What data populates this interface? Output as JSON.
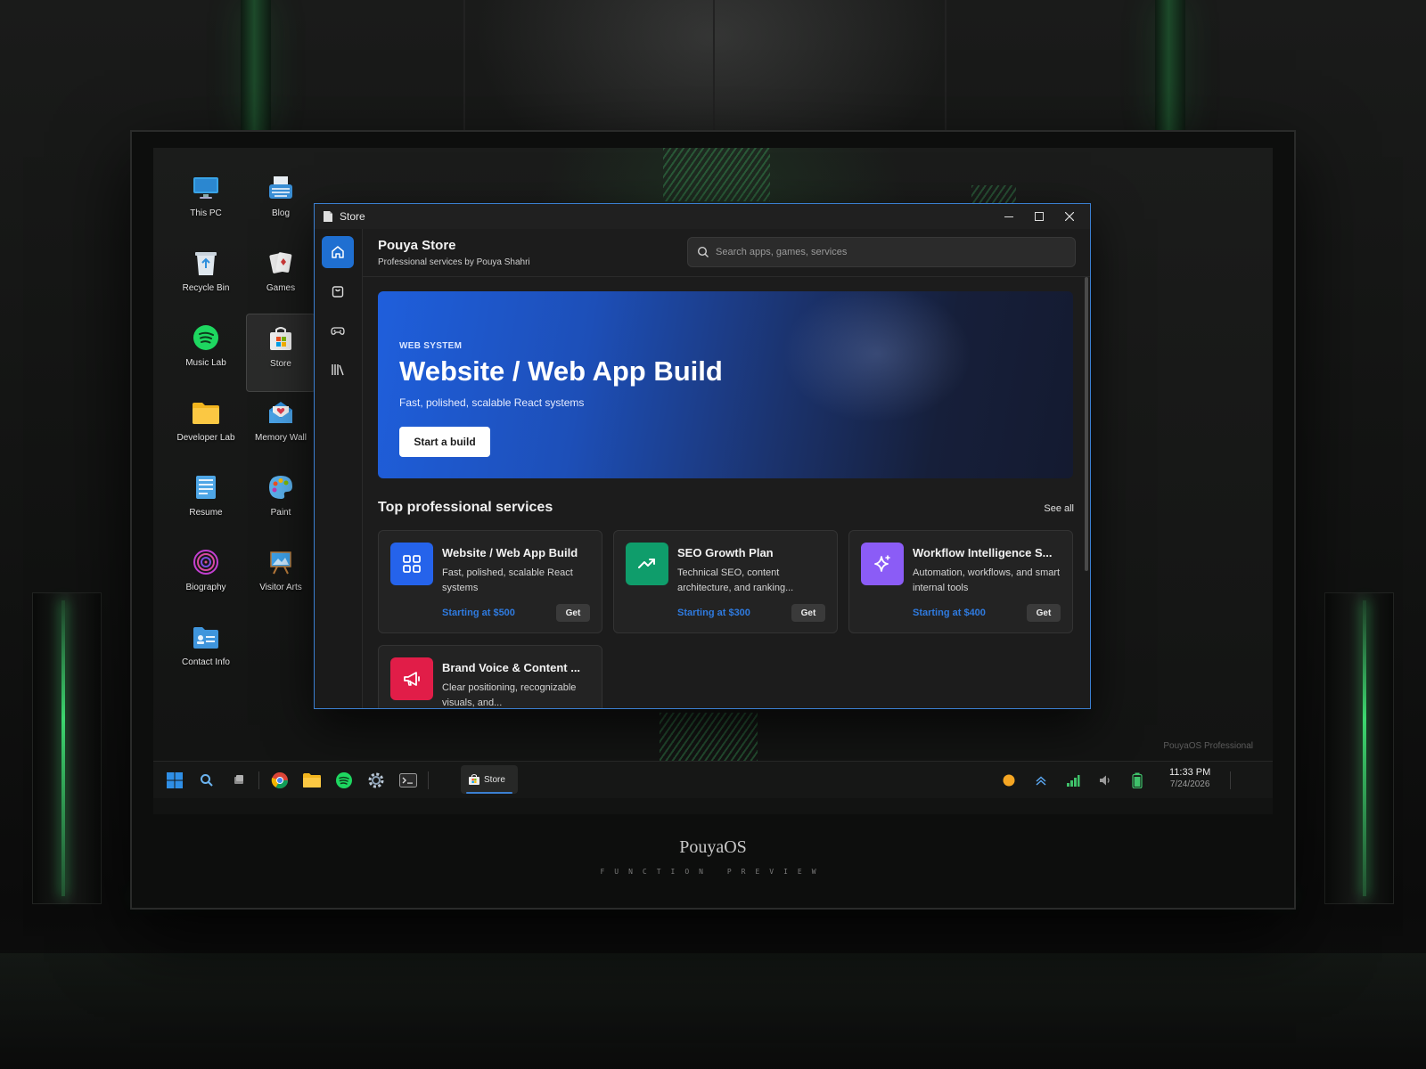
{
  "desktop": {
    "icons": [
      {
        "label": "This PC",
        "icon": "monitor-icon"
      },
      {
        "label": "Blog",
        "icon": "typewriter-icon"
      },
      {
        "label": "Recycle Bin",
        "icon": "recycle-bin-icon"
      },
      {
        "label": "Games",
        "icon": "playing-cards-icon"
      },
      {
        "label": "Music Lab",
        "icon": "spotify-icon"
      },
      {
        "label": "Store",
        "icon": "store-bag-icon"
      },
      {
        "label": "Developer Lab",
        "icon": "folder-icon"
      },
      {
        "label": "Memory Wall",
        "icon": "heart-envelope-icon"
      },
      {
        "label": "Resume",
        "icon": "notepad-icon"
      },
      {
        "label": "Paint",
        "icon": "palette-icon"
      },
      {
        "label": "Biography",
        "icon": "fingerprint-icon"
      },
      {
        "label": "Visitor Arts",
        "icon": "easel-icon"
      },
      {
        "label": "Contact Info",
        "icon": "contact-card-icon"
      }
    ],
    "watermark": "PouyaOS Professional"
  },
  "window": {
    "title": "Store",
    "controls": {
      "minimize": "minimize-icon",
      "maximize": "maximize-icon",
      "close": "close-icon"
    }
  },
  "nav_rail": {
    "items": [
      "home-icon",
      "bag-icon",
      "gamepad-icon",
      "library-icon"
    ],
    "active": "home-icon"
  },
  "store": {
    "title": "Pouya Store",
    "subtitle": "Professional services by Pouya Shahri",
    "search_placeholder": "Search apps, games, services"
  },
  "hero": {
    "tag": "WEB SYSTEM",
    "title": "Website / Web App Build",
    "description": "Fast, polished, scalable React systems",
    "button": "Start a build"
  },
  "section": {
    "title": "Top professional services",
    "see_all": "See all"
  },
  "services": [
    {
      "title": "Website / Web App Build",
      "description": "Fast, polished, scalable React systems",
      "price": "Starting at $500",
      "action": "Get",
      "icon": "grid-icon",
      "color": "#2563eb"
    },
    {
      "title": "SEO Growth Plan",
      "description": "Technical SEO, content architecture, and ranking...",
      "price": "Starting at $300",
      "action": "Get",
      "icon": "trend-up-icon",
      "color": "#0f9d6b"
    },
    {
      "title": "Workflow Intelligence S...",
      "description": "Automation, workflows, and smart internal tools",
      "price": "Starting at $400",
      "action": "Get",
      "icon": "sparkle-icon",
      "color": "#8b5cf6"
    },
    {
      "title": "Brand Voice & Content ...",
      "description": "Clear positioning, recognizable visuals, and...",
      "price": "",
      "action": "",
      "icon": "megaphone-icon",
      "color": "#e11d48"
    }
  ],
  "taskbar": {
    "apps": [
      "windows-start-icon",
      "search-icon",
      "task-view-icon",
      "chrome-icon",
      "folder-icon",
      "spotify-icon",
      "settings-icon",
      "terminal-icon"
    ],
    "active_app_label": "Store",
    "tray": [
      "status-dot-icon",
      "chevron-up-icon",
      "signal-icon",
      "volume-icon",
      "battery-icon"
    ],
    "time": "11:33 PM",
    "date": "7/24/2026"
  },
  "branding": {
    "name": "PouyaOS",
    "subtitle": "FUNCTION PREVIEW"
  }
}
